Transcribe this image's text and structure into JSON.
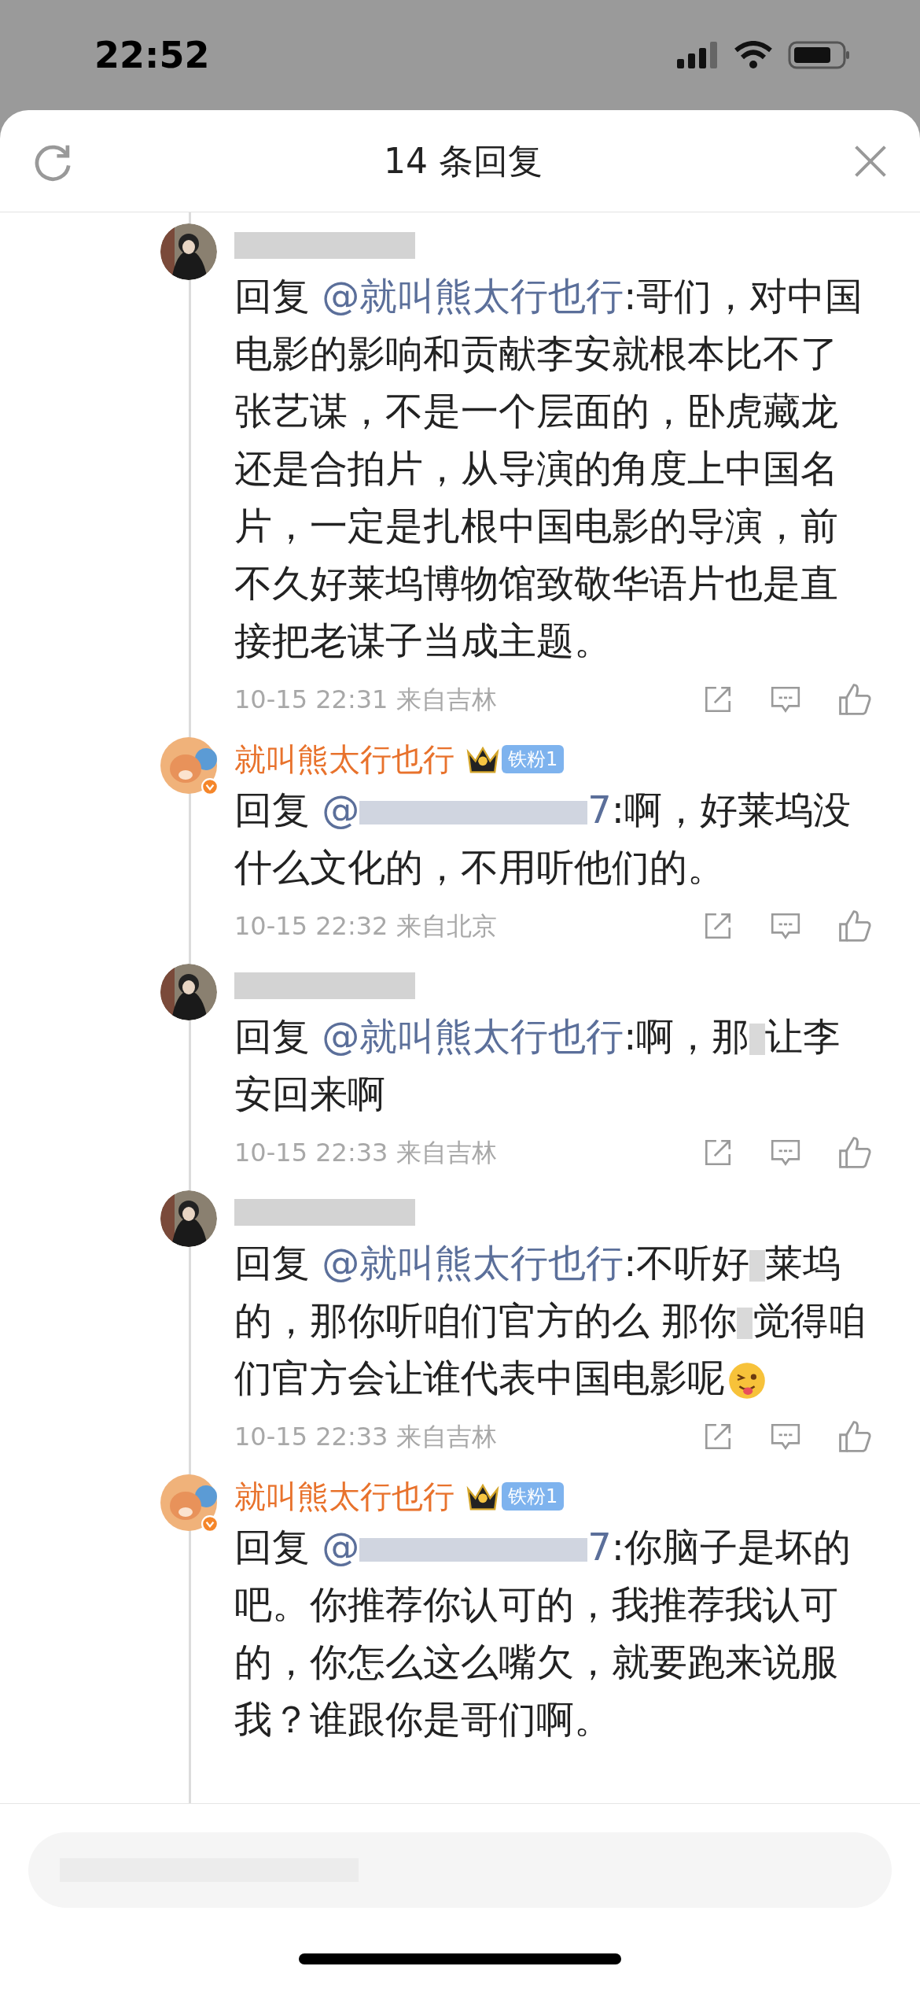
{
  "status_bar": {
    "time": "22:52"
  },
  "header": {
    "title": "14 条回复"
  },
  "comments": [
    {
      "body": [
        {
          "kind": "text",
          "text": "回复 "
        },
        {
          "kind": "mention",
          "text": "@就叫熊太行也行"
        },
        {
          "kind": "text",
          "text": ":哥们，对中国电影的影响和贡献李安就根本比不了张艺谋，不是一个层面的，卧虎藏龙还是合拍片，从导演的角度上中国名片，一定是扎根中国电影的导演，前不久好莱坞博物馆致敬华语片也是直接把老谋子当成主题。"
        }
      ],
      "meta": "10-15 22:31 来自吉林"
    },
    {
      "avatar": {
        "kind": "cartoon"
      },
      "name": "就叫熊太行也行",
      "badge": "铁粉1",
      "body": [
        {
          "kind": "text",
          "text": "回复 "
        },
        {
          "kind": "mention",
          "text": "@"
        },
        {
          "kind": "redacted_word"
        },
        {
          "kind": "mention",
          "text": "7"
        },
        {
          "kind": "text",
          "text": ":啊，好莱坞没什么文化的，不用听他们的。"
        }
      ],
      "meta": "10-15 22:32 来自北京"
    },
    {
      "body": [
        {
          "kind": "text",
          "text": "回复 "
        },
        {
          "kind": "mention",
          "text": "@就叫熊太行也行"
        },
        {
          "kind": "text",
          "text": ":啊，那"
        },
        {
          "kind": "redacted_char"
        },
        {
          "kind": "text",
          "text": "让李安回来啊"
        }
      ],
      "meta": "10-15 22:33 来自吉林"
    },
    {
      "body": [
        {
          "kind": "text",
          "text": "回复 "
        },
        {
          "kind": "mention",
          "text": "@就叫熊太行也行"
        },
        {
          "kind": "text",
          "text": ":不听好"
        },
        {
          "kind": "redacted_char"
        },
        {
          "kind": "text",
          "text": "莱坞的，那你听咱们官方的么 那你"
        },
        {
          "kind": "redacted_char"
        },
        {
          "kind": "text",
          "text": "觉得咱们官方会让谁代表中国电影呢"
        },
        {
          "kind": "emoji"
        }
      ],
      "meta": "10-15 22:33 来自吉林"
    },
    {
      "avatar": {
        "kind": "cartoon"
      },
      "name": "就叫熊太行也行",
      "badge": "铁粉1",
      "body": [
        {
          "kind": "text",
          "text": "回复 "
        },
        {
          "kind": "mention",
          "text": "@"
        },
        {
          "kind": "redacted_word"
        },
        {
          "kind": "mention",
          "text": "7"
        },
        {
          "kind": "text",
          "text": ":你脑子是坏的吧。你推荐你认可的，我推荐我认可的，你怎么这么嘴欠，就要跑来说服我？谁跟你是哥们啊。"
        }
      ]
    }
  ]
}
